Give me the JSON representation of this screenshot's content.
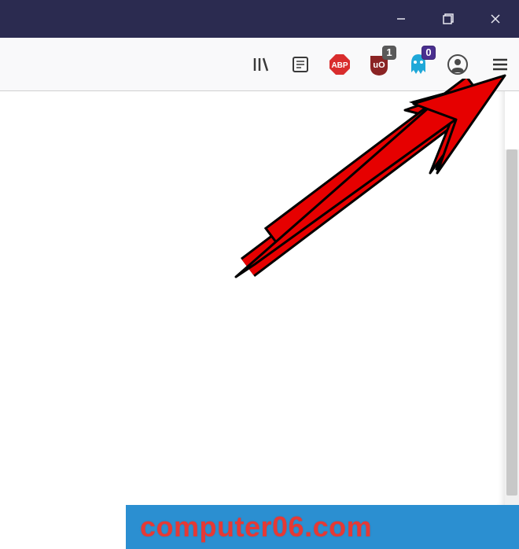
{
  "window": {
    "minimize_label": "Minimize",
    "maximize_label": "Restore",
    "close_label": "Close"
  },
  "toolbar": {
    "library_label": "Library",
    "reader_label": "Reader View",
    "adblock_label": "ABP",
    "ublock_label": "uBlock",
    "ublock_badge": "1",
    "ghostery_label": "Ghostery",
    "ghostery_badge": "0",
    "account_label": "Account",
    "menu_label": "Menu"
  },
  "watermark": "computer06.com"
}
